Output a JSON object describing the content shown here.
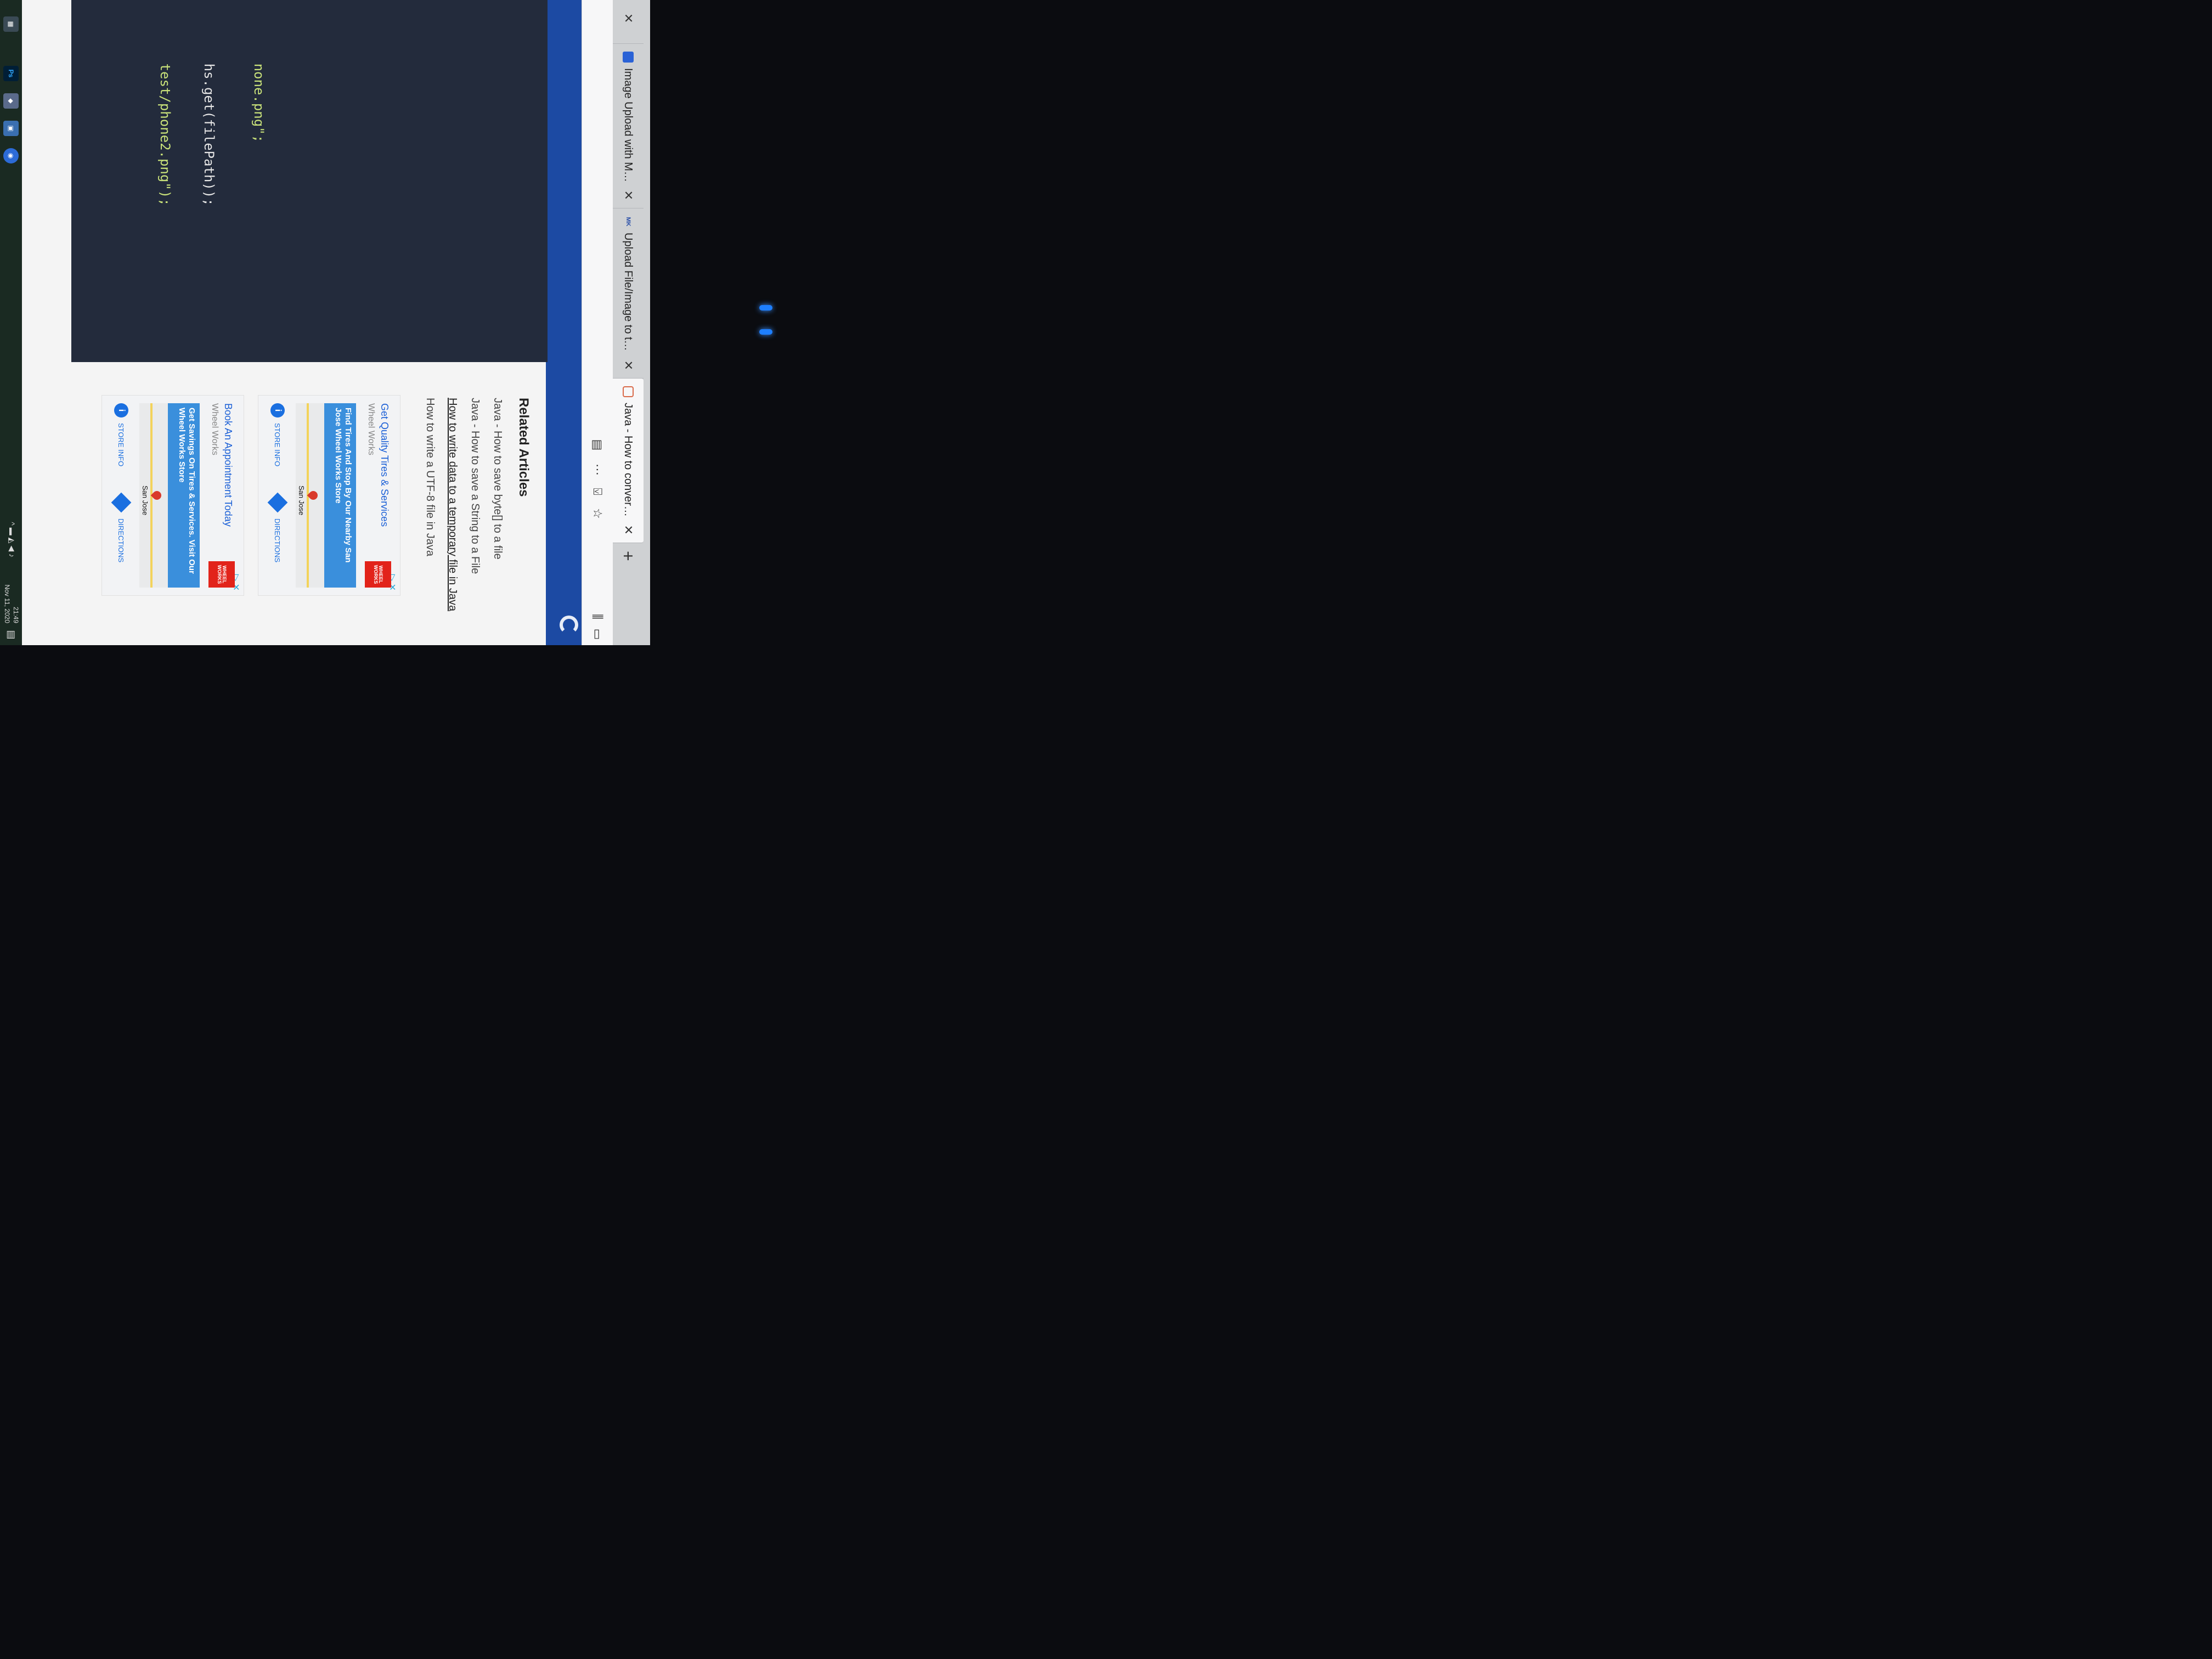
{
  "browser": {
    "tabs": [
      {
        "title": "Image Upload with Multipa",
        "favicon": "blue-square"
      },
      {
        "title": "Upload File/Image to the se",
        "favicon": "MK"
      },
      {
        "title": "Java - How to convert File to",
        "favicon": "page-icon",
        "active": true
      }
    ],
    "new_tab_label": "+",
    "toolbar_icons": [
      "reader-view-icon",
      "more-icon",
      "pocket-icon",
      "bookmark-star-icon",
      "library-icon",
      "sidebar-icon"
    ]
  },
  "code": {
    "lines": [
      {
        "text": "none.png\";",
        "string": true
      },
      {
        "text": "hs.get(filePath));",
        "string": false
      },
      {
        "text": "test/phone2.png\");",
        "string": true
      }
    ]
  },
  "related": {
    "heading": "Related Articles",
    "links": [
      "Java - How to save byte[] to a file",
      "Java - How to save a String to a File",
      "How to write data to a temporary file in Java",
      "How to write a UTF-8 file in Java"
    ],
    "hovered_index": 2
  },
  "ads": [
    {
      "headline": "Get Quality Tires & Services",
      "advertiser": "Wheel Works",
      "logo_text": "WHEEL WORKS",
      "cta": "Find Tires And Stop By Our Nearby San Jose Wheel Works Store",
      "city": "San Jose",
      "store_info": "STORE INFO",
      "directions": "DIRECTIONS"
    },
    {
      "headline": "Book An Appointment Today",
      "advertiser": "Wheel Works",
      "logo_text": "WHEEL WORKS",
      "cta": "Get Savings On Tires & Services. Visit Our Wheel Works Store",
      "city": "San Jose",
      "store_info": "STORE INFO",
      "directions": "DIRECTIONS"
    }
  ],
  "taskbar": {
    "apps": [
      "file-explorer",
      "photoshop",
      "3d-viewer",
      "control-panel",
      "messenger"
    ],
    "ps_label": "Ps",
    "time": "21:49",
    "date": "Nov 11, 2020"
  },
  "colors": {
    "accent_blue": "#1c4aa3",
    "code_bg": "#232b3c",
    "link_blue": "#1a5fd6",
    "ad_red": "#e2231a"
  }
}
